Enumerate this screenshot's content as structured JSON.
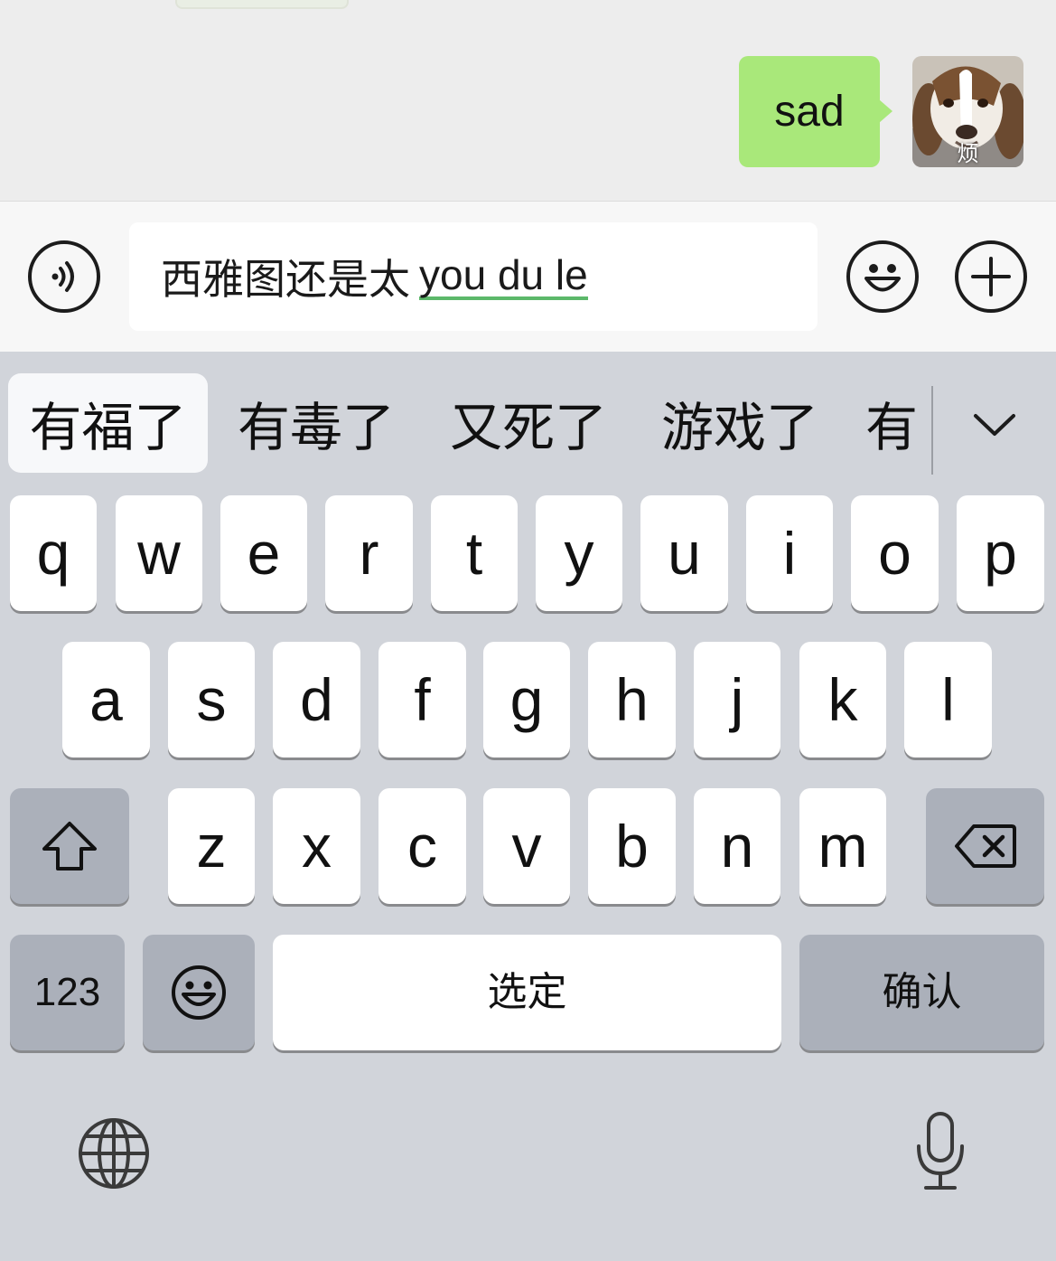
{
  "chat": {
    "message": "sad",
    "avatar_caption": "烦",
    "colors": {
      "bubble": "#a9e87a",
      "background": "#ededed"
    }
  },
  "input_bar": {
    "voice_icon": "voice-icon",
    "committed_text": "西雅图还是太",
    "composing_text": "you du le",
    "emoji_icon": "emoji-icon",
    "plus_icon": "plus-icon"
  },
  "candidates": [
    "有福了",
    "有毒了",
    "又死了",
    "游戏了",
    "有"
  ],
  "keyboard": {
    "row1": [
      "q",
      "w",
      "e",
      "r",
      "t",
      "y",
      "u",
      "i",
      "o",
      "p"
    ],
    "row2": [
      "a",
      "s",
      "d",
      "f",
      "g",
      "h",
      "j",
      "k",
      "l"
    ],
    "row3": [
      "z",
      "x",
      "c",
      "v",
      "b",
      "n",
      "m"
    ],
    "numbers_label": "123",
    "space_label": "选定",
    "confirm_label": "确认",
    "shift_icon": "shift-icon",
    "delete_icon": "backspace-icon",
    "globe_icon": "globe-icon",
    "mic_icon": "microphone-icon"
  }
}
